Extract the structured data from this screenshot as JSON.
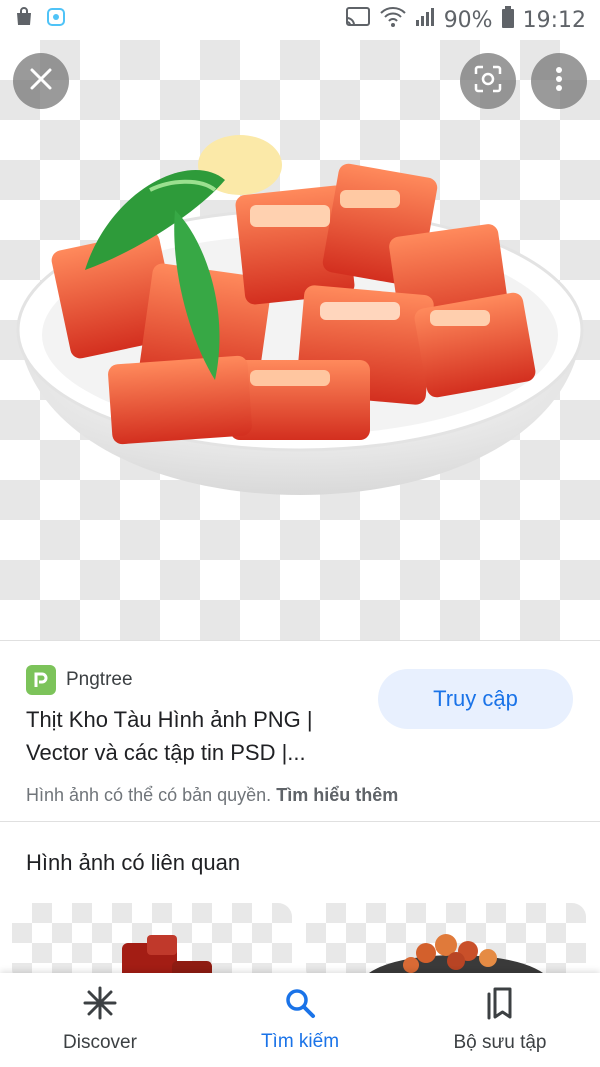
{
  "status_bar": {
    "battery_percent": "90%",
    "time": "19:12",
    "icons": [
      "shopping-bag-icon",
      "app-notification-icon",
      "cast-icon",
      "wifi-icon",
      "signal-icon",
      "battery-icon"
    ]
  },
  "viewer": {
    "icons": [
      "close-icon",
      "lens-icon",
      "more-vert-icon"
    ]
  },
  "source": {
    "site_name": "Pngtree",
    "title": "Thịt Kho Tàu Hình ảnh PNG | Vector và các tập tin PSD |...",
    "visit_label": "Truy cập",
    "copyright_text": "Hình ảnh có thể có bản quyền.",
    "learn_more": "Tìm hiểu thêm"
  },
  "related": {
    "heading": "Hình ảnh có liên quan"
  },
  "bottom_nav": {
    "items": [
      {
        "label": "Discover",
        "icon": "asterisk-icon"
      },
      {
        "label": "Tìm kiếm",
        "icon": "search-icon",
        "active": true
      },
      {
        "label": "Bộ sưu tập",
        "icon": "collections-icon"
      }
    ]
  },
  "colors": {
    "accent": "#1a73e8",
    "visit_bg": "#e8f0fe",
    "pngtree_green": "#7cc35a"
  }
}
